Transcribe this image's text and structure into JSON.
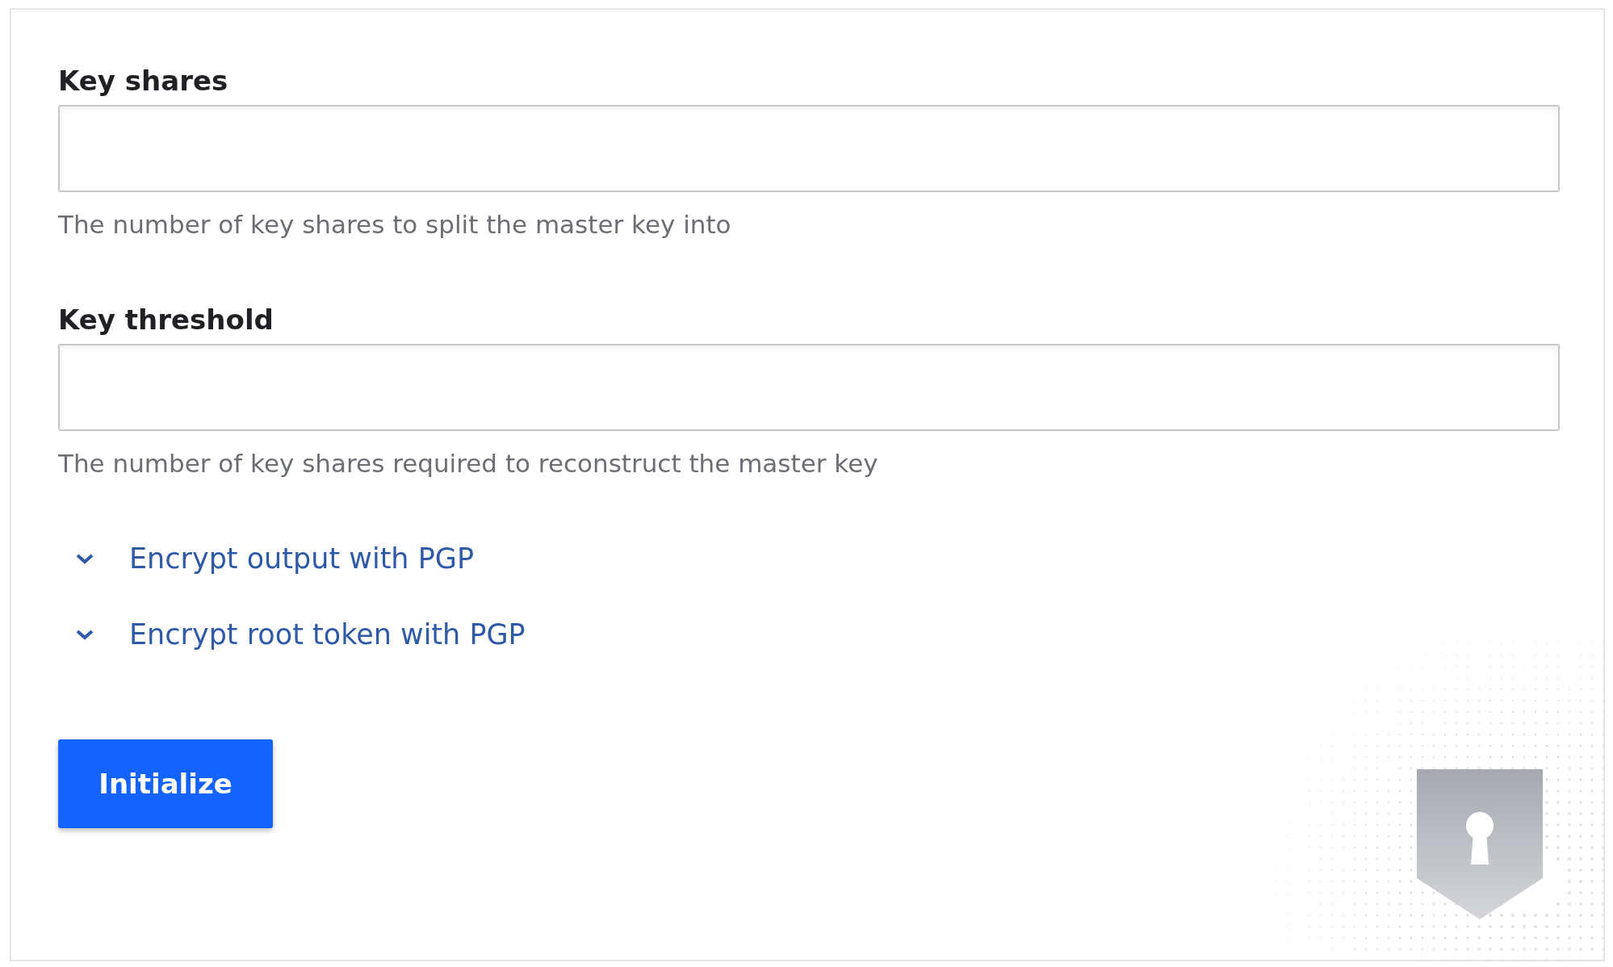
{
  "fields": [
    {
      "label": "Key shares",
      "help": "The number of key shares to split the master key into"
    },
    {
      "label": "Key threshold",
      "help": "The number of key shares required to reconstruct the master key"
    }
  ],
  "toggles": [
    {
      "label": "Encrypt output with PGP",
      "expanded": false
    },
    {
      "label": "Encrypt root token with PGP",
      "expanded": false
    }
  ],
  "button": {
    "label": "Initialize"
  }
}
